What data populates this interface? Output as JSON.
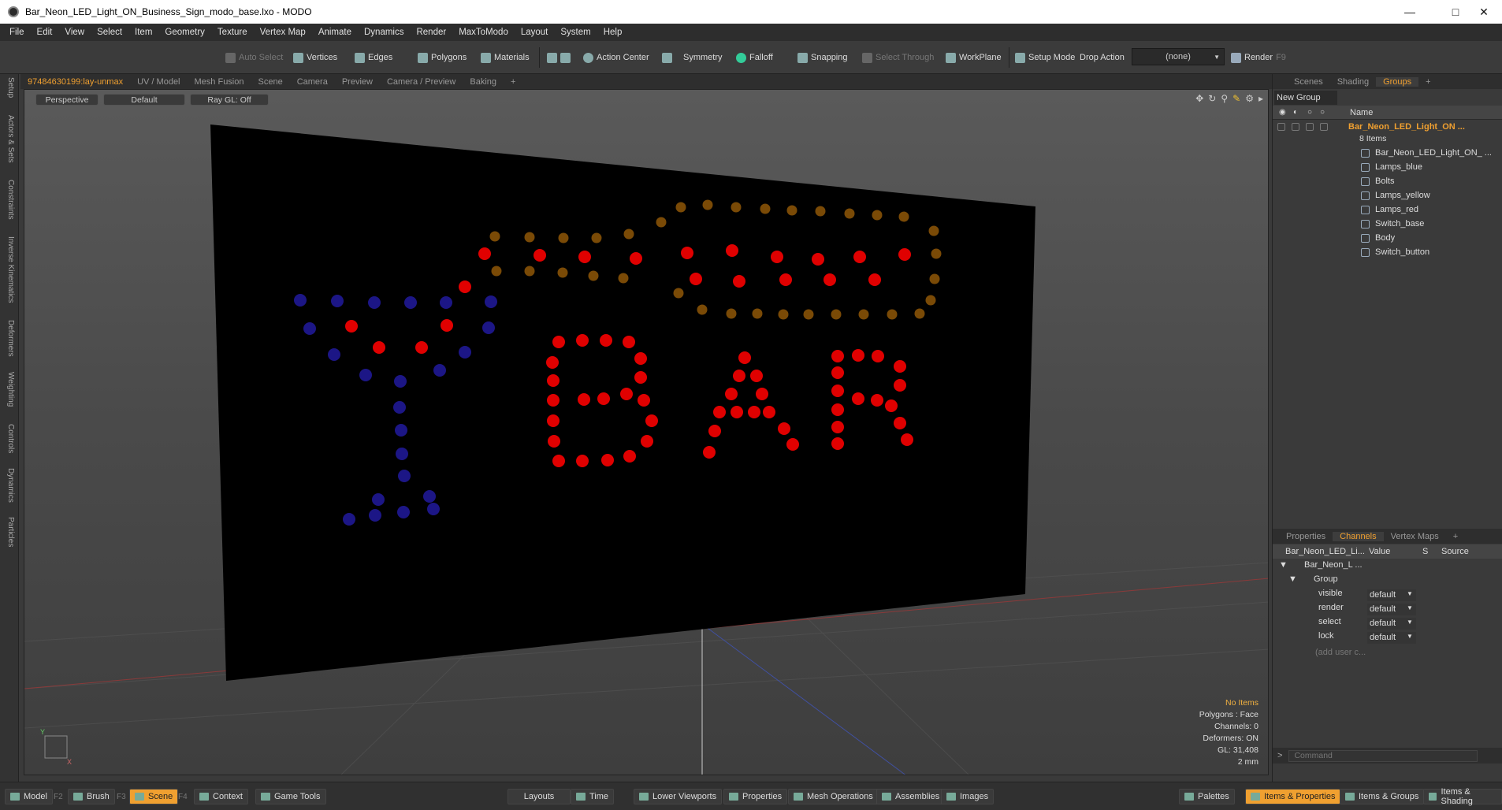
{
  "window": {
    "title": "Bar_Neon_LED_Light_ON_Business_Sign_modo_base.lxo - MODO"
  },
  "menu": [
    "File",
    "Edit",
    "View",
    "Select",
    "Item",
    "Geometry",
    "Texture",
    "Vertex Map",
    "Animate",
    "Dynamics",
    "Render",
    "MaxToModo",
    "Layout",
    "System",
    "Help"
  ],
  "toolbar": {
    "auto_select": "Auto Select",
    "vertices": "Vertices",
    "edges": "Edges",
    "polygons": "Polygons",
    "materials": "Materials",
    "action_center": "Action Center",
    "symmetry": "Symmetry",
    "falloff": "Falloff",
    "snapping": "Snapping",
    "select_through": "Select Through",
    "workplane": "WorkPlane",
    "setup_mode": "Setup Mode",
    "drop_action": "Drop Action",
    "drop_value": "(none)",
    "render": "Render",
    "render_key": "F9"
  },
  "left_tabs": [
    "Setup",
    "Actors & Sets",
    "Constraints",
    "Inverse Kinematics",
    "Deformers",
    "Weighting",
    "Controls",
    "Dynamics",
    "Particles"
  ],
  "viewport_tabs": [
    "97484630199:lay-unmax",
    "UV / Model",
    "Mesh Fusion",
    "Scene",
    "Camera",
    "Preview",
    "Camera / Preview",
    "Baking",
    "+"
  ],
  "viewport": {
    "perspective": "Perspective",
    "shading": "Default",
    "raygl": "Ray GL: Off"
  },
  "status": {
    "items": "No Items",
    "polygons": "Polygons : Face",
    "channels": "Channels: 0",
    "deformers": "Deformers: ON",
    "gl": "GL: 31,408",
    "scale": "2 mm"
  },
  "sign": {
    "text": "BAR",
    "colors": {
      "blue": "#1c1686",
      "red": "#e00000",
      "yellow": "#7a4a06",
      "board": "#000000"
    }
  },
  "right_tabs": [
    "Scenes",
    "Shading",
    "Groups",
    "+"
  ],
  "groups": {
    "new_group": "New Group",
    "name_header": "Name",
    "root": "Bar_Neon_LED_Light_ON ...",
    "count": "8 Items",
    "items": [
      "Bar_Neon_LED_Light_ON_ ...",
      "Lamps_blue",
      "Bolts",
      "Lamps_yellow",
      "Lamps_red",
      "Switch_base",
      "Body",
      "Switch_button"
    ]
  },
  "props_tabs": [
    "Properties",
    "Channels",
    "Vertex Maps",
    "+"
  ],
  "channels": {
    "headers": {
      "name": "Bar_Neon_LED_Li...",
      "value": "Value",
      "s": "S",
      "source": "Source"
    },
    "tree": [
      "Bar_Neon_L ...",
      "Group"
    ],
    "rows": [
      {
        "name": "visible",
        "value": "default"
      },
      {
        "name": "render",
        "value": "default"
      },
      {
        "name": "select",
        "value": "default"
      },
      {
        "name": "lock",
        "value": "default"
      }
    ],
    "add": "(add user c..."
  },
  "command": {
    "placeholder": "Command"
  },
  "bottom": {
    "model": "Model",
    "model_key": "F2",
    "brush": "Brush",
    "brush_key": "F3",
    "scene": "Scene",
    "scene_key": "F4",
    "context": "Context",
    "game_tools": "Game Tools",
    "layouts": "Layouts",
    "time": "Time",
    "lower_viewports": "Lower Viewports",
    "properties": "Properties",
    "mesh_ops": "Mesh Operations",
    "assemblies": "Assemblies",
    "images": "Images",
    "palettes": "Palettes",
    "items_props": "Items & Properties",
    "items_groups": "Items & Groups",
    "items_shading": "Items & Shading"
  }
}
